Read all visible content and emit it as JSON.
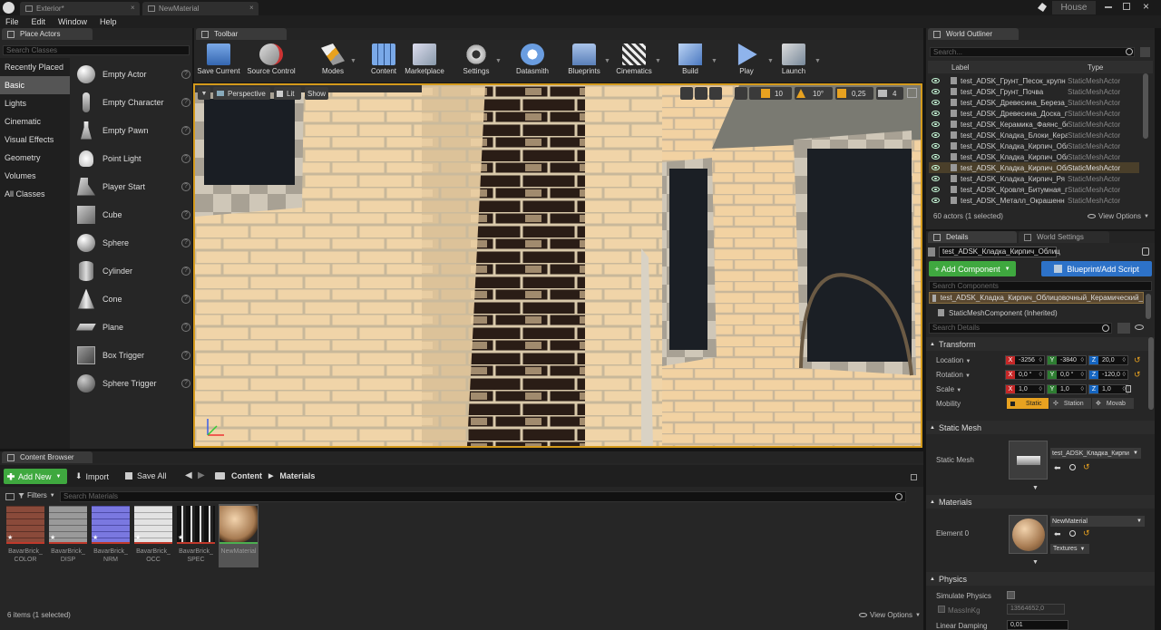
{
  "app": {
    "tabs": [
      {
        "label": "Exterior*"
      },
      {
        "label": "NewMaterial"
      }
    ],
    "project": "House",
    "menu": [
      "File",
      "Edit",
      "Window",
      "Help"
    ]
  },
  "place_actors": {
    "title": "Place Actors",
    "search_placeholder": "Search Classes",
    "categories": [
      "Recently Placed",
      "Basic",
      "Lights",
      "Cinematic",
      "Visual Effects",
      "Geometry",
      "Volumes",
      "All Classes"
    ],
    "active_category": "Basic",
    "items": [
      "Empty Actor",
      "Empty Character",
      "Empty Pawn",
      "Point Light",
      "Player Start",
      "Cube",
      "Sphere",
      "Cylinder",
      "Cone",
      "Plane",
      "Box Trigger",
      "Sphere Trigger"
    ]
  },
  "toolbar": {
    "title": "Toolbar",
    "buttons": [
      "Save Current",
      "Source Control",
      "Modes",
      "Content",
      "Marketplace",
      "Settings",
      "Datasmith",
      "Blueprints",
      "Cinematics",
      "Build",
      "Play",
      "Launch"
    ]
  },
  "viewport": {
    "perspective": "Perspective",
    "lit": "Lit",
    "show": "Show",
    "grid_snap": "10",
    "rot_snap": "10°",
    "scale_snap": "0,25",
    "cam_speed": "4"
  },
  "outliner": {
    "title": "World Outliner",
    "search_placeholder": "Search...",
    "col_label": "Label",
    "col_type": "Type",
    "rows": [
      {
        "name": "test_ADSK_Грунт_Песок_крупн",
        "type": "StaticMeshActor"
      },
      {
        "name": "test_ADSK_Грунт_Почва",
        "type": "StaticMeshActor"
      },
      {
        "name": "test_ADSK_Древесина_Береза_",
        "type": "StaticMeshActor"
      },
      {
        "name": "test_ADSK_Древесина_Доска_п",
        "type": "StaticMeshActor"
      },
      {
        "name": "test_ADSK_Керамика_Фаянс_бе",
        "type": "StaticMeshActor"
      },
      {
        "name": "test_ADSK_Кладка_Блоки_Кера",
        "type": "StaticMeshActor"
      },
      {
        "name": "test_ADSK_Кладка_Кирпич_Обл",
        "type": "StaticMeshActor"
      },
      {
        "name": "test_ADSK_Кладка_Кирпич_Обл",
        "type": "StaticMeshActor"
      },
      {
        "name": "test_ADSK_Кладка_Кирпич_Обл",
        "type": "StaticMeshActor"
      },
      {
        "name": "test_ADSK_Кладка_Кирпич_Ря",
        "type": "StaticMeshActor"
      },
      {
        "name": "test_ADSK_Кровля_Битумная_г",
        "type": "StaticMeshActor"
      },
      {
        "name": "test_ADSK_Металл_Окрашенн",
        "type": "StaticMeshActor"
      }
    ],
    "selected_index": 8,
    "count": "60 actors (1 selected)",
    "view_options": "View Options"
  },
  "details": {
    "tab_details": "Details",
    "tab_world": "World Settings",
    "actor_name": "test_ADSK_Кладка_Кирпич_Облиц",
    "add_component": "+ Add Component",
    "blueprint": "Blueprint/Add Script",
    "search_components": "Search Components",
    "root": "test_ADSK_Кладка_Кирпич_Облицовочный_Керамический_",
    "component": "StaticMeshComponent (Inherited)",
    "search_details": "Search Details",
    "transform": "Transform",
    "location_label": "Location",
    "rotation_label": "Rotation",
    "scale_label": "Scale",
    "mobility_label": "Mobility",
    "location": [
      "-3256",
      "-3840",
      "20,0"
    ],
    "rotation": [
      "0,0 °",
      "0,0 °",
      "-120,0"
    ],
    "scale": [
      "1,0",
      "1,0",
      "1,0"
    ],
    "mobility": [
      "Static",
      "Station",
      "Movab"
    ],
    "static_mesh_section": "Static Mesh",
    "static_mesh_label": "Static Mesh",
    "static_mesh_value": "test_ADSK_Кладка_Кирпи",
    "materials_section": "Materials",
    "element_label": "Element 0",
    "material_value": "NewMaterial",
    "textures": "Textures",
    "physics_section": "Physics",
    "simulate": "Simulate Physics",
    "mass_label": "MassInKg",
    "mass_value": "13564652,0",
    "linear_damping": "Linear Damping",
    "linear_value": "0,01"
  },
  "content_browser": {
    "title": "Content Browser",
    "add_new": "Add New",
    "import": "Import",
    "save_all": "Save All",
    "path": [
      "Content",
      "Materials"
    ],
    "filters": "Filters",
    "search_placeholder": "Search Materials",
    "assets": [
      {
        "line1": "BavarBrick_",
        "line2": "COLOR",
        "accent": "#c0392b"
      },
      {
        "line1": "BavarBrick_",
        "line2": "DISP",
        "accent": "#c0392b"
      },
      {
        "line1": "BavarBrick_",
        "line2": "NRM",
        "accent": "#c0392b"
      },
      {
        "line1": "BavarBrick_",
        "line2": "OCC",
        "accent": "#c0392b"
      },
      {
        "line1": "BavarBrick_",
        "line2": "SPEC",
        "accent": "#c0392b"
      },
      {
        "line1": "NewMaterial",
        "line2": "",
        "accent": "#4caf50"
      }
    ],
    "status": "6 items (1 selected)",
    "view_options": "View Options"
  },
  "colors": {
    "accent_orange": "#e8a220",
    "add_green": "#3fa83f",
    "blueprint_blue": "#2d72c8",
    "selected_row": "#4a3f2a"
  }
}
